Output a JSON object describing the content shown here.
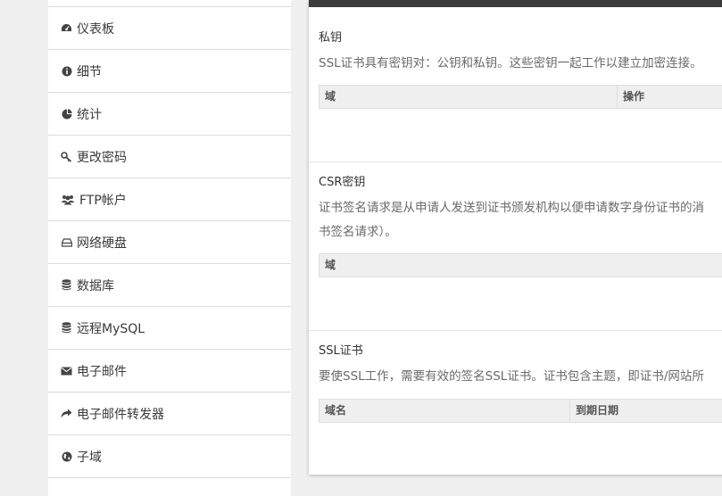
{
  "sidebar": {
    "items": [
      {
        "label": "",
        "icon": "none"
      },
      {
        "label": "仪表板",
        "icon": "dashboard-icon"
      },
      {
        "label": "细节",
        "icon": "info-icon"
      },
      {
        "label": "统计",
        "icon": "pie-chart-icon"
      },
      {
        "label": "更改密码",
        "icon": "key-icon"
      },
      {
        "label": "FTP帐户",
        "icon": "users-icon"
      },
      {
        "label": "网络硬盘",
        "icon": "hdd-icon"
      },
      {
        "label": "数据库",
        "icon": "database-icon"
      },
      {
        "label": "远程MySQL",
        "icon": "database-icon"
      },
      {
        "label": "电子邮件",
        "icon": "envelope-icon"
      },
      {
        "label": "电子邮件转发器",
        "icon": "share-icon"
      },
      {
        "label": "子域",
        "icon": "globe-icon"
      }
    ]
  },
  "private_key": {
    "title": "私钥",
    "description": "SSL证书具有密钥对：公钥和私钥。这些密钥一起工作以建立加密连接。",
    "columns": [
      "域",
      "操作"
    ]
  },
  "csr": {
    "title": "CSR密钥",
    "description_line1": "证书签名请求是从申请人发送到证书颁发机构以便申请数字身份证书的消",
    "description_line2": "书签名请求）。",
    "columns": [
      "域"
    ]
  },
  "ssl_cert": {
    "title": "SSL证书",
    "description": "要使SSL工作，需要有效的签名SSL证书。证书包含主题，即证书/网站所",
    "columns": [
      "域名",
      "到期日期"
    ]
  },
  "colors": {
    "topbar": "#3b3b3b",
    "table_header": "#efefef",
    "sidebar_bg": "#ffffff",
    "page_bg": "#f0f0f0"
  }
}
